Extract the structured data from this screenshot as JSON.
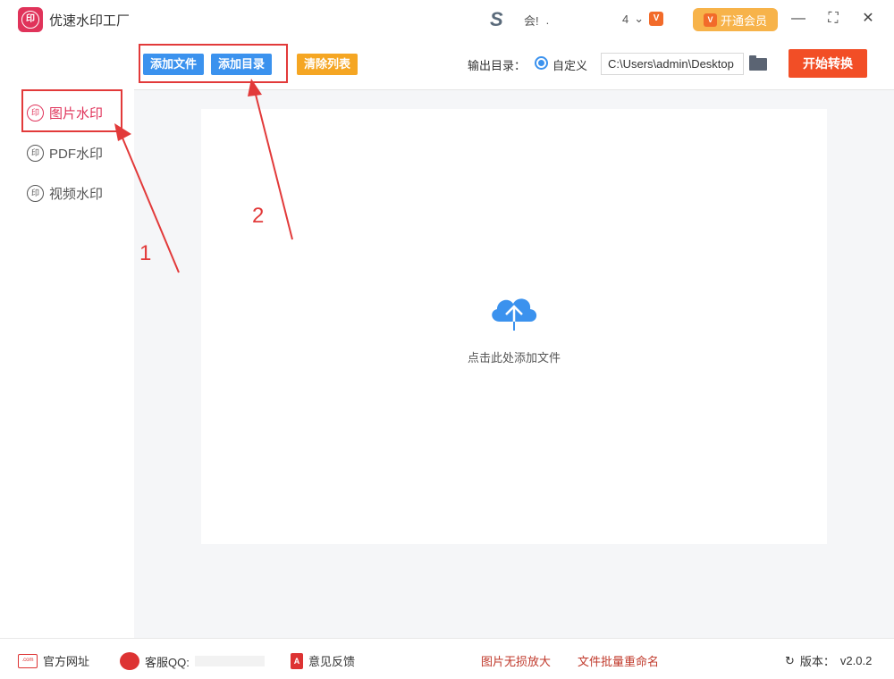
{
  "app": {
    "title": "优速水印工厂",
    "logo_text": "印"
  },
  "header": {
    "user_logo": "S",
    "user_name": "会!",
    "user_name_suffix": ".",
    "notification_count": "4",
    "notification_chevron": "⌄",
    "vip_icon": "V",
    "vip_label": "开通会员",
    "minimize": "—",
    "maximize": "⛶",
    "close": "✕"
  },
  "sidebar": {
    "items": [
      {
        "label": "图片水印",
        "icon": "印",
        "active": true
      },
      {
        "label": "PDF水印",
        "icon": "印",
        "active": false
      },
      {
        "label": "视频水印",
        "icon": "印",
        "active": false
      }
    ]
  },
  "toolbar": {
    "add_file": "添加文件",
    "add_folder": "添加目录",
    "clear_list": "清除列表",
    "output_label": "输出目录：",
    "radio_label": "自定义",
    "output_path": "C:\\Users\\admin\\Desktop",
    "start": "开始转换"
  },
  "dropzone": {
    "text": "点击此处添加文件"
  },
  "annotations": {
    "one": "1",
    "two": "2"
  },
  "footer": {
    "website": "官方网址",
    "website_icon": ".com",
    "qq": "客服QQ:",
    "feedback": "意见反馈",
    "feedback_icon": "A",
    "link1": "图片无损放大",
    "link2": "文件批量重命名",
    "version_label": "版本：",
    "version": "v2.0.2",
    "version_icon": "↻"
  },
  "colors": {
    "brand": "#e0335a",
    "primary": "#3b92ee",
    "accent": "#f24e26",
    "warning": "#f5a623",
    "annotation": "#e23a3a"
  }
}
